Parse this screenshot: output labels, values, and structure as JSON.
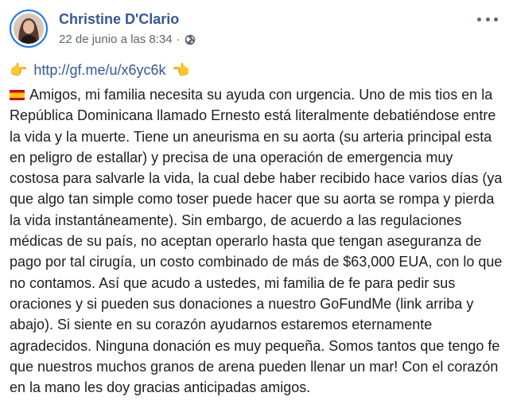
{
  "post": {
    "author": "Christine D'Clario",
    "timestamp": "22 de junio a las 8:34",
    "separator": "·",
    "privacy_icon": "globe-icon",
    "link_prefix_emoji": "👉",
    "link_suffix_emoji": "👉",
    "link_text": "http://gf.me/u/x6yc6k",
    "flag_icon": "spain-flag-icon",
    "body": "Amigos, mi familia necesita su ayuda con urgencia. Uno de mis tios en la República Dominicana llamado Ernesto está literalmente debatiéndose entre la vida y la muerte. Tiene un aneurisma en su aorta (su arteria principal esta en peligro de estallar) y precisa de una operación de emergencia muy costosa para salvarle la vida, la cual debe haber recibido hace varios días (ya que algo tan simple como toser puede hacer que su aorta se rompa y pierda la vida instantáneamente). Sin embargo, de acuerdo a las regulaciones médicas de su país, no aceptan operarlo hasta que tengan aseguranza de pago por tal cirugía, un costo combinado de más de $63,000 EUA, con lo que no contamos. Así que acudo a ustedes, mi familia de fe para pedir sus oraciones y si pueden sus donaciones a nuestro GoFundMe (link arriba y abajo). Si siente en su corazón ayudarnos estaremos eternamente agradecidos. Ninguna donación es muy pequeña. Somos tantos que tengo fe que nuestros muchos granos de arena pueden llenar un mar! Con el corazón en la mano les doy gracias anticipadas amigos."
  },
  "colors": {
    "name_link": "#385898",
    "meta_gray": "#616770",
    "text": "#1c1e21",
    "avatar_ring": "#1877f2"
  }
}
